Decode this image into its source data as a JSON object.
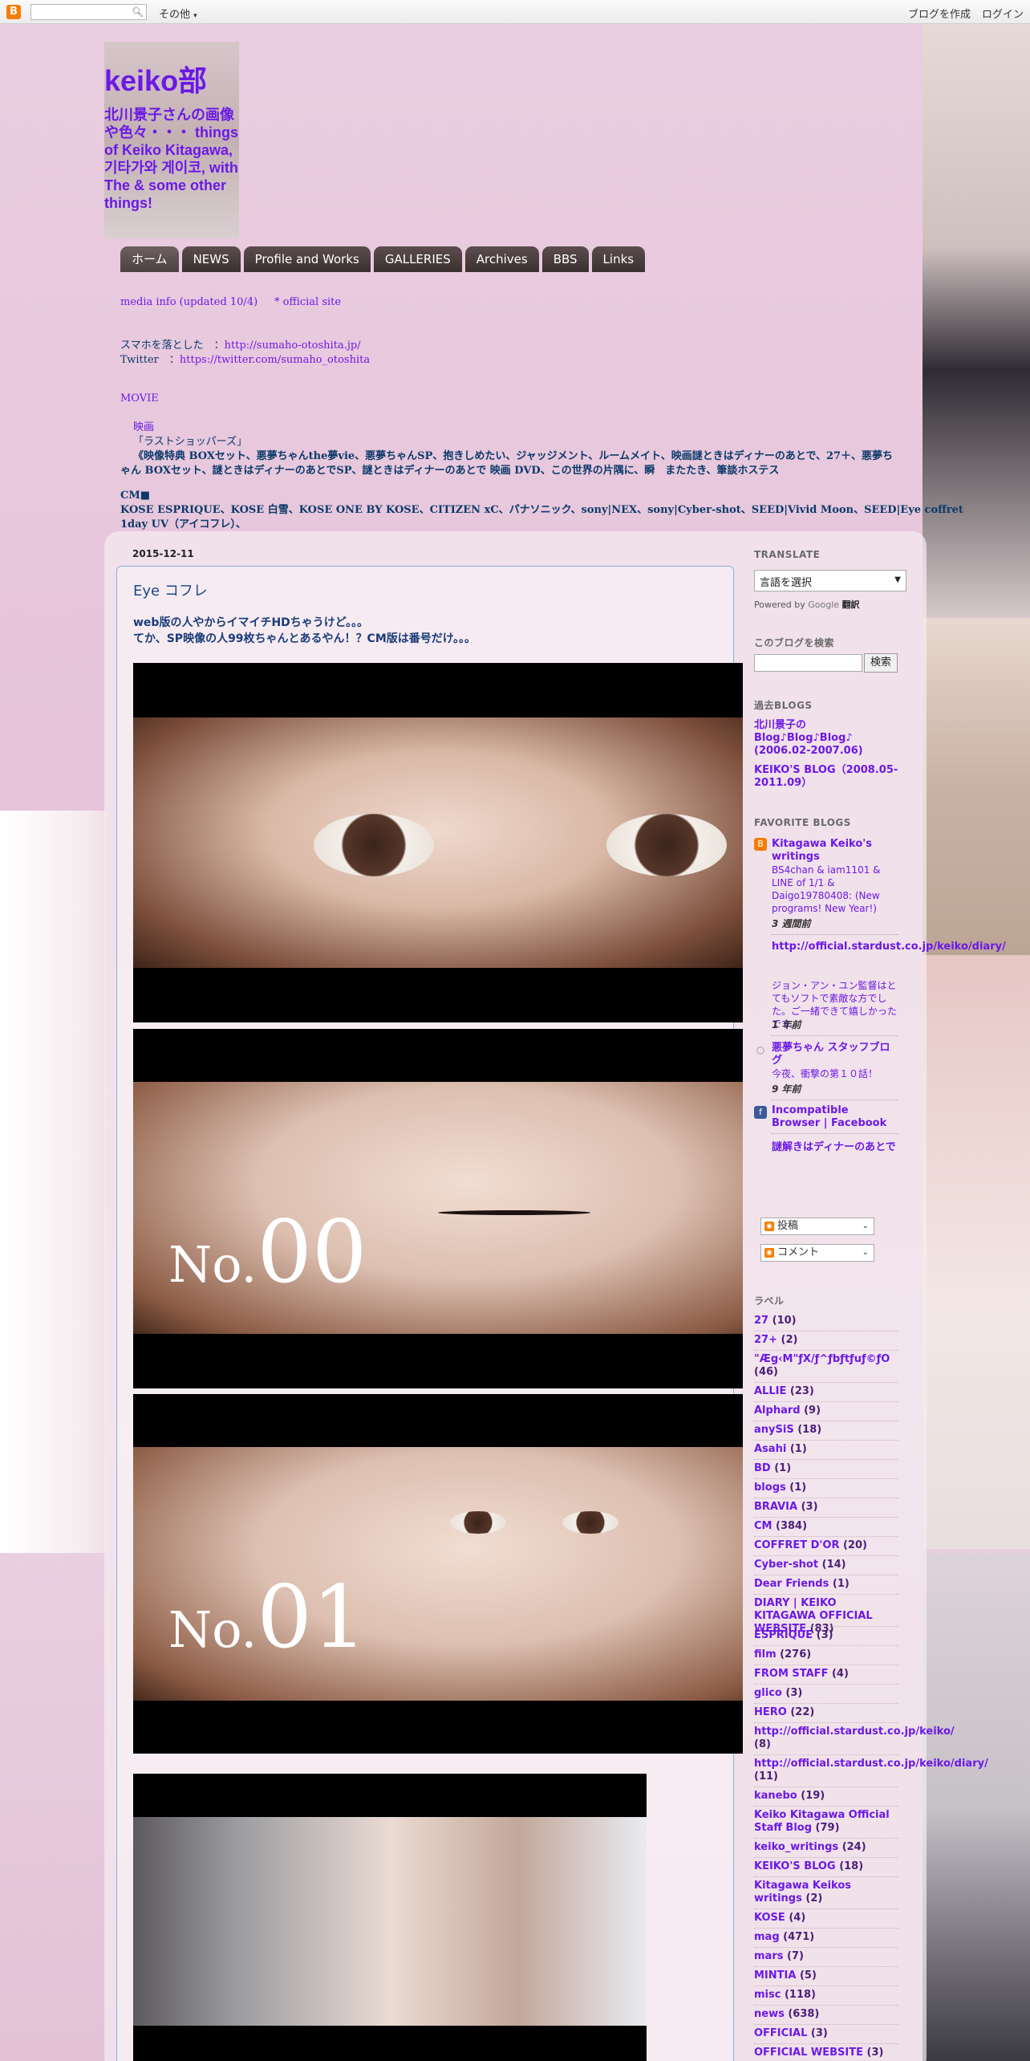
{
  "navbar": {
    "logo": "B",
    "search_icon": "magnifier-icon",
    "more_label": "その他",
    "create_blog": "ブログを作成",
    "login": "ログイン"
  },
  "header": {
    "title": "keiko部",
    "description": "北川景子さんの画像や色々・・・ things of Keiko Kitagawa, 기타가와 게이코, with The & some other things!"
  },
  "tabs": [
    "ホーム",
    "NEWS",
    "Profile and Works",
    "GALLERIES",
    "Archives",
    "BBS",
    "Links"
  ],
  "info": {
    "line1a": "media info (updated 10/4)",
    "line1b": "* official site",
    "line2_label": "スマホを落とした",
    "line2_url": "http://sumaho-otoshita.jp/",
    "line3_label": "Twitter",
    "line3_url": "https://twitter.com/sumaho_otoshita",
    "line4": "MOVIE",
    "line5": "映画",
    "line6": "「ラストショッパーズ」",
    "line7": "《映像特典 BOXセット、悪夢ちゃんthe夢vie、悪夢ちゃんSP、抱きしめたい、ジャッジメント、ルームメイト、映画謎ときはディナーのあとで、27＋、悪夢ち",
    "line8": "ゃん BOXセット、謎ときはディナーのあとでSP、謎ときはディナーのあとで 映画 DVD、この世界の片隅に、瞬　またたき、筆談ホステス",
    "line9": "CM■",
    "line10": "KOSE ESPRIQUE、KOSE 白雪、KOSE ONE BY KOSE、CITIZEN xC、パナソニック、sony|NEX、sony|Cyber-shot、SEED|Vivid Moon、SEED|Eye coffret",
    "line11": "1day UV（アイコフレ）、"
  },
  "post": {
    "date": "2015-12-11",
    "title": "Eye コフレ",
    "body_line1": "web版の人やからイマイチHDちゃうけど。。。",
    "body_line2": "てか、SP映像の人99枚ちゃんとあるやん！？CM版は番号だけ。。。",
    "image2_label_no": "No.",
    "image2_label_num": "00",
    "image3_label_no": "No.",
    "image3_label_num": "01"
  },
  "sidebar": {
    "translate_head": "TRANSLATE",
    "translate_select": "言語を選択",
    "powered_by": "Powered by",
    "google": "Google",
    "translate_word": "翻訳",
    "search_head": "このブログを検索",
    "search_button": "検索",
    "past_head": "過去BLOGS",
    "past_links": [
      "北川景子の Blog♪Blog♪Blog♪ (2006.02-2007.06)",
      "KEIKO'S BLOG（2008.05-2011.09）"
    ],
    "fav_head": "FAVORITE BLOGS",
    "fav": [
      {
        "title": "Kitagawa Keiko's writings",
        "snippet": "BS4chan & iam1101 & LINE of 1/1 & Daigo19780408: (New programs! New Year!)",
        "time": "3 週間前",
        "icon": "blogger-icon"
      },
      {
        "title": "http://official.stardust.co.jp/keiko/diary/",
        "snippet": "ジョン・アン・ユン監督はとてもソフトで素敵な方でした。ご一緒できて嬉しかったです。",
        "time": "1 年前",
        "icon": "blank-icon"
      },
      {
        "title": "悪夢ちゃん スタッフブログ",
        "snippet": "今夜、衝撃の第１０話！",
        "time": "9 年前",
        "icon": "blank-icon"
      },
      {
        "title": "Incompatible Browser | Facebook",
        "snippet": "",
        "time": "",
        "icon": "facebook-icon"
      },
      {
        "title": "謎解きはディナーのあとで",
        "snippet": "",
        "time": "",
        "icon": "blank-icon"
      }
    ],
    "feed_posts": "投稿",
    "feed_comments": "コメント",
    "labels_head": "ラベル",
    "labels": [
      {
        "name": "27",
        "count": "(10)"
      },
      {
        "name": "27+",
        "count": "(2)"
      },
      {
        "name": "\"Æg‹M\"ƒX/ƒ^ƒbƒtƒuƒ©ƒO",
        "count": "(46)"
      },
      {
        "name": "ALLIE",
        "count": "(23)"
      },
      {
        "name": "Alphard",
        "count": "(9)"
      },
      {
        "name": "anySiS",
        "count": "(18)"
      },
      {
        "name": "Asahi",
        "count": "(1)"
      },
      {
        "name": "BD",
        "count": "(1)"
      },
      {
        "name": "blogs",
        "count": "(1)"
      },
      {
        "name": "BRAVIA",
        "count": "(3)"
      },
      {
        "name": "CM",
        "count": "(384)"
      },
      {
        "name": "COFFRET D'OR",
        "count": "(20)"
      },
      {
        "name": "Cyber-shot",
        "count": "(14)"
      },
      {
        "name": "Dear Friends",
        "count": "(1)"
      },
      {
        "name": "DIARY | KEIKO KITAGAWA OFFICIAL WEBSITE",
        "count": "(83)"
      },
      {
        "name": "ESPRIQUE",
        "count": "(3)"
      },
      {
        "name": "film",
        "count": "(276)"
      },
      {
        "name": "FROM STAFF",
        "count": "(4)"
      },
      {
        "name": "glico",
        "count": "(3)"
      },
      {
        "name": "HERO",
        "count": "(22)"
      },
      {
        "name": "http://official.stardust.co.jp/keiko/",
        "count": "(8)"
      },
      {
        "name": "http://official.stardust.co.jp/keiko/diary/",
        "count": "(11)"
      },
      {
        "name": "kanebo",
        "count": "(19)"
      },
      {
        "name": "Keiko Kitagawa Official Staff Blog",
        "count": "(79)"
      },
      {
        "name": "keiko_writings",
        "count": "(24)"
      },
      {
        "name": "KEIKO'S BLOG",
        "count": "(18)"
      },
      {
        "name": "Kitagawa Keikos writings",
        "count": "(2)"
      },
      {
        "name": "KOSE",
        "count": "(4)"
      },
      {
        "name": "mag",
        "count": "(471)"
      },
      {
        "name": "mars",
        "count": "(7)"
      },
      {
        "name": "MINTIA",
        "count": "(5)"
      },
      {
        "name": "misc",
        "count": "(118)"
      },
      {
        "name": "news",
        "count": "(638)"
      },
      {
        "name": "OFFICIAL",
        "count": "(3)"
      },
      {
        "name": "OFFICIAL WEBSITE",
        "count": "(3)"
      }
    ]
  }
}
